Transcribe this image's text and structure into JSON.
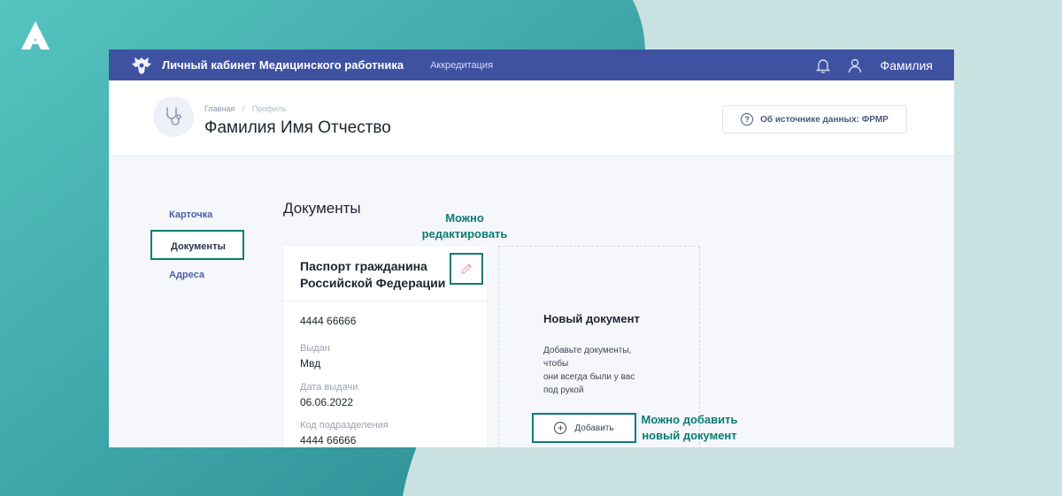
{
  "topbar": {
    "app_title": "Личный кабинет Медицинского работника",
    "nav_link": "Аккредитация",
    "user_name": "Фамилия"
  },
  "header": {
    "breadcrumb": [
      "Главная",
      "Профиль"
    ],
    "title": "Фамилия Имя Отчество",
    "source_button": "Об источнике данных: ФРМР"
  },
  "sidebar": {
    "items": [
      {
        "label": "Карточка"
      },
      {
        "label": "Документы"
      },
      {
        "label": "Адреса"
      }
    ]
  },
  "main": {
    "section_title": "Документы",
    "document": {
      "title": "Паспорт гражданина Российской Федерации",
      "number": "4444 66666",
      "fields": [
        {
          "label": "Выдан",
          "value": "Мвд"
        },
        {
          "label": "Дата выдачи",
          "value": "06.06.2022"
        },
        {
          "label": "Код подразделения",
          "value": "4444 66666"
        }
      ]
    },
    "new_document": {
      "title": "Новый документ",
      "description": "Добавьте документы,\nчтобы\nони всегда были у вас\nпод рукой",
      "add_button": "Добавить"
    }
  },
  "callouts": {
    "edit_line1": "Можно",
    "edit_line2": "редактировать",
    "add_line1": "Можно добавить",
    "add_line2": "новый документ"
  },
  "colors": {
    "topbar": "#3f52a2",
    "accent": "#0c7c73",
    "background_teal": "#3aa8a8",
    "background_light": "#c9e1e0"
  }
}
